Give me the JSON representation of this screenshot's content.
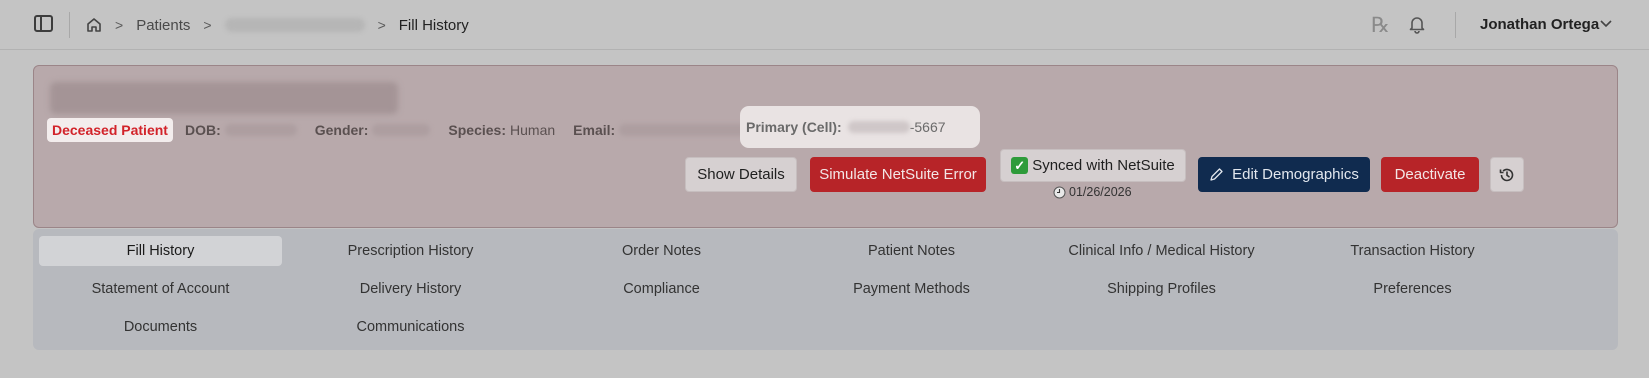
{
  "topbar": {
    "breadcrumbs": [
      "Patients",
      "Fill History"
    ],
    "rx_symbol": "℞",
    "user_name": "Jonathan Ortega"
  },
  "patient": {
    "status_badge": "Deceased Patient",
    "dob_label": "DOB:",
    "gender_label": "Gender:",
    "species_label": "Species:",
    "species_value": "Human",
    "email_label": "Email:",
    "phone_label": "Primary (Cell):",
    "phone_suffix": "-5667"
  },
  "actions": {
    "show_details": "Show Details",
    "simulate_error": "Simulate NetSuite Error",
    "synced_label": "Synced with NetSuite",
    "synced_check": "✓",
    "synced_date": "01/26/2026",
    "edit_demographics": "Edit Demographics",
    "deactivate": "Deactivate"
  },
  "tabs": [
    {
      "label": "Fill History",
      "active": true
    },
    {
      "label": "Prescription History"
    },
    {
      "label": "Order Notes"
    },
    {
      "label": "Patient Notes"
    },
    {
      "label": "Clinical Info / Medical History"
    },
    {
      "label": "Transaction History"
    },
    {
      "label": "Statement of Account"
    },
    {
      "label": "Delivery History"
    },
    {
      "label": "Compliance"
    },
    {
      "label": "Payment Methods"
    },
    {
      "label": "Shipping Profiles"
    },
    {
      "label": "Preferences"
    },
    {
      "label": "Documents"
    },
    {
      "label": "Communications"
    }
  ],
  "colors": {
    "danger": "#b72428",
    "primary": "#102b4f",
    "success": "#2e9b3a"
  }
}
